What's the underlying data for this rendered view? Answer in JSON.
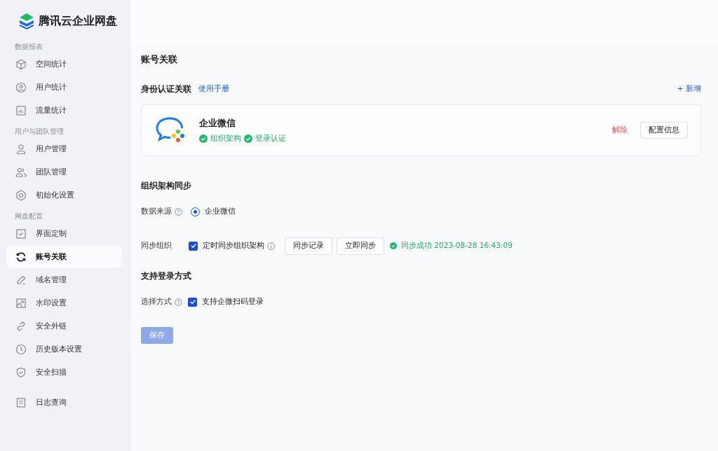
{
  "brand": {
    "name": "腾讯云企业网盘"
  },
  "sidebar": {
    "groups": [
      {
        "label": "数据报表",
        "items": [
          {
            "label": "空间统计",
            "selected": false
          },
          {
            "label": "用户统计",
            "selected": false
          },
          {
            "label": "流量统计",
            "selected": false
          }
        ]
      },
      {
        "label": "用户与团队管理",
        "items": [
          {
            "label": "用户管理",
            "selected": false
          },
          {
            "label": "团队管理",
            "selected": false
          },
          {
            "label": "初始化设置",
            "selected": false
          }
        ]
      },
      {
        "label": "网盘配置",
        "items": [
          {
            "label": "界面定制",
            "selected": false
          },
          {
            "label": "账号关联",
            "selected": true
          },
          {
            "label": "域名管理",
            "selected": false
          },
          {
            "label": "水印设置",
            "selected": false
          },
          {
            "label": "安全外链",
            "selected": false
          },
          {
            "label": "历史版本设置",
            "selected": false
          },
          {
            "label": "安全扫描",
            "selected": false
          }
        ]
      },
      {
        "items": [
          {
            "label": "日志查询",
            "selected": false
          }
        ]
      }
    ]
  },
  "page_title": "账号关联",
  "identity": {
    "title": "身份认证关联",
    "manual_link": "使用手册",
    "add_link": "+ 新增",
    "providers": [
      {
        "name": "企业微信",
        "tags": [
          "组织架构",
          "登录认证"
        ],
        "unbind": "解除",
        "config_button": "配置信息"
      }
    ]
  },
  "org_sync": {
    "title": "组织架构同步",
    "source": {
      "label": "数据来源",
      "options": [
        {
          "label": "企业微信",
          "selected": true
        }
      ]
    },
    "sync": {
      "label": "同步组织",
      "checkbox": {
        "label": "定时同步组织架构",
        "checked": true
      },
      "buttons": [
        "同步记录",
        "立即同步"
      ],
      "status": "同步成功 2023-08-28 16:43:09"
    }
  },
  "login": {
    "title": "支持登录方式",
    "method": {
      "label": "选择方式",
      "options": [
        {
          "label": "支持企微扫码登录",
          "checked": true
        }
      ]
    }
  },
  "save_button": {
    "label": "保存",
    "disabled": true
  }
}
